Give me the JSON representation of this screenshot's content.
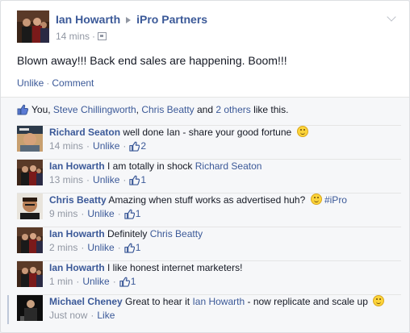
{
  "post": {
    "author": "Ian Howarth",
    "target": "iPro Partners",
    "time": "14 mins",
    "text": "Blown away!!! Back end sales are happening. Boom!!!",
    "actions": {
      "unlike": "Unlike",
      "comment": "Comment"
    }
  },
  "likes": {
    "you": "You",
    "sep1": ", ",
    "person1": "Steve Chillingworth",
    "sep2": ", ",
    "person2": "Chris Beatty",
    "and": " and ",
    "others": "2 others",
    "suffix": " like this."
  },
  "comments": [
    {
      "author": "Richard Seaton",
      "text": "well done Ian - share your good fortune",
      "mention": "",
      "hashtag": "",
      "time": "14 mins",
      "action": "Unlike",
      "likes": "2",
      "smiley": true
    },
    {
      "author": "Ian Howarth",
      "text": "I am totally in shock",
      "mention": "Richard Seaton",
      "hashtag": "",
      "time": "13 mins",
      "action": "Unlike",
      "likes": "1",
      "smiley": false
    },
    {
      "author": "Chris Beatty",
      "text": "Amazing when stuff works as advertised huh?",
      "mention": "",
      "hashtag": "#iPro",
      "time": "9 mins",
      "action": "Unlike",
      "likes": "1",
      "smiley": true
    },
    {
      "author": "Ian Howarth",
      "text": "Definitely",
      "mention": "Chris Beatty",
      "hashtag": "",
      "time": "2 mins",
      "action": "Unlike",
      "likes": "1",
      "smiley": false
    },
    {
      "author": "Ian Howarth",
      "text": "I like honest internet marketers!",
      "mention": "",
      "hashtag": "",
      "time": "1 min",
      "action": "Unlike",
      "likes": "1",
      "smiley": false
    },
    {
      "author": "Michael Cheney",
      "text": "Great to hear it",
      "mention": "Ian Howarth",
      "text2": "- now replicate and scale up",
      "hashtag": "",
      "time": "Just now",
      "action": "Like",
      "likes": "",
      "smiley": true
    }
  ],
  "colors": {
    "link": "#3b5998",
    "meta": "#9197a3",
    "feedback_bg": "#f6f7f9"
  }
}
